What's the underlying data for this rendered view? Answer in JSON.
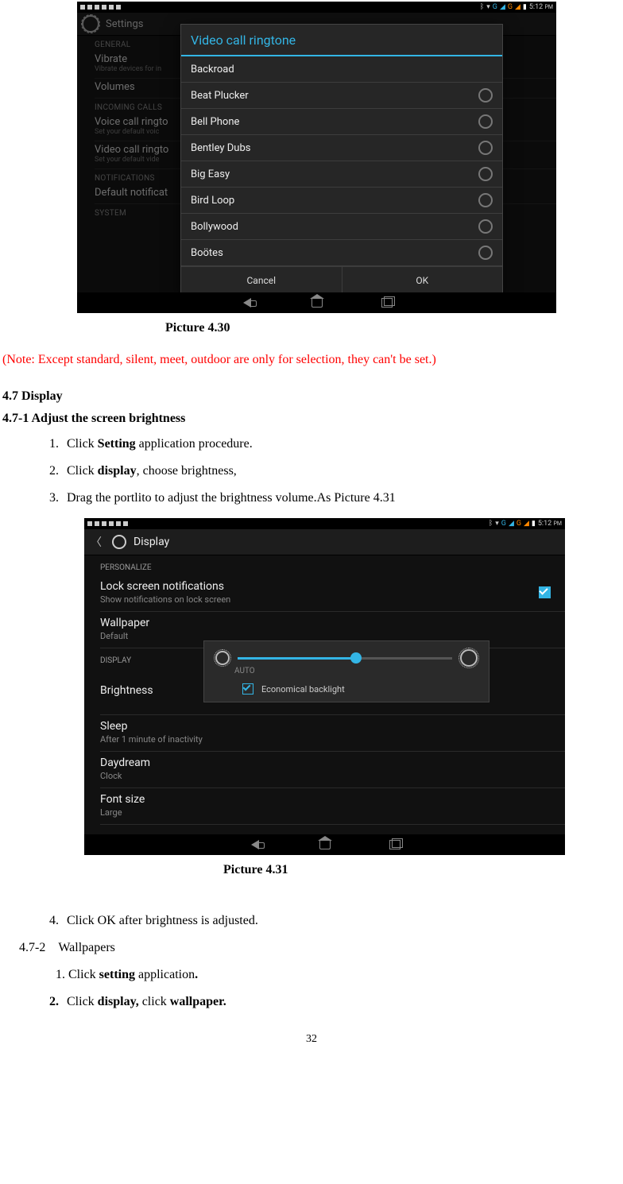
{
  "statusbar": {
    "time": "5:12",
    "ampm_suffix": "PM",
    "g_label": "G",
    "g_label2": "G"
  },
  "shot1": {
    "header_title": "Settings",
    "bg": {
      "cat_general": "GENERAL",
      "vibrate": {
        "t": "Vibrate",
        "s": "Vibrate devices for in"
      },
      "volumes": {
        "t": "Volumes"
      },
      "cat_incoming": "INCOMING CALLS",
      "voice_ring": {
        "t": "Voice call ringto",
        "s": "Set your default voic"
      },
      "video_ring": {
        "t": "Video call ringto",
        "s": "Set your default vide"
      },
      "cat_notifications": "NOTIFICATIONS",
      "default_notif": {
        "t": "Default notificat"
      },
      "cat_system": "SYSTEM"
    },
    "dialog": {
      "title": "Video call ringtone",
      "options": [
        "Backroad",
        "Beat Plucker",
        "Bell Phone",
        "Bentley Dubs",
        "Big Easy",
        "Bird Loop",
        "Bollywood",
        "Boötes"
      ],
      "cancel": "Cancel",
      "ok": "OK"
    }
  },
  "caption_430": "Picture 4.30",
  "note_red": "(Note: Except standard, silent, meet, outdoor are only for selection, they can't be set.)",
  "section_47": "4.7 Display",
  "section_471": "4.7-1 Adjust the screen brightness",
  "steps_471": {
    "s1_pre": "Click ",
    "s1_bold": "Setting",
    "s1_post": " application procedure.",
    "s2_pre": "Click ",
    "s2_bold": "display",
    "s2_post": ", choose brightness,",
    "s3": "Drag the portlito to adjust the brightness volume.As Picture 4.31"
  },
  "shot2": {
    "header_title": "Display",
    "cat_personalize": "PERSONALIZE",
    "lock_notif": {
      "t": "Lock screen notifications",
      "s": "Show notifications on lock screen"
    },
    "wallpaper": {
      "t": "Wallpaper",
      "s": "Default"
    },
    "cat_display": "DISPLAY",
    "brightness": {
      "t": "Brightness"
    },
    "sleep": {
      "t": "Sleep",
      "s": "After 1 minute of inactivity"
    },
    "daydream": {
      "t": "Daydream",
      "s": "Clock"
    },
    "fontsize": {
      "t": "Font size",
      "s": "Large"
    },
    "popup": {
      "auto": "AUTO",
      "eco": "Economical backlight"
    }
  },
  "caption_431": "Picture 4.31",
  "step4": "Click OK after brightness is adjusted.",
  "section_472_label": "4.7-2",
  "section_472_title": "Wallpapers",
  "step_472_1_pre": "1. Click ",
  "step_472_1_bold": "setting",
  "step_472_1_post": " application",
  "step_472_1_dot": ".",
  "step_472_2_pre": "Click ",
  "step_472_2_b1": "display,",
  "step_472_2_mid": " click ",
  "step_472_2_b2": "wallpaper.",
  "page_number": "32"
}
